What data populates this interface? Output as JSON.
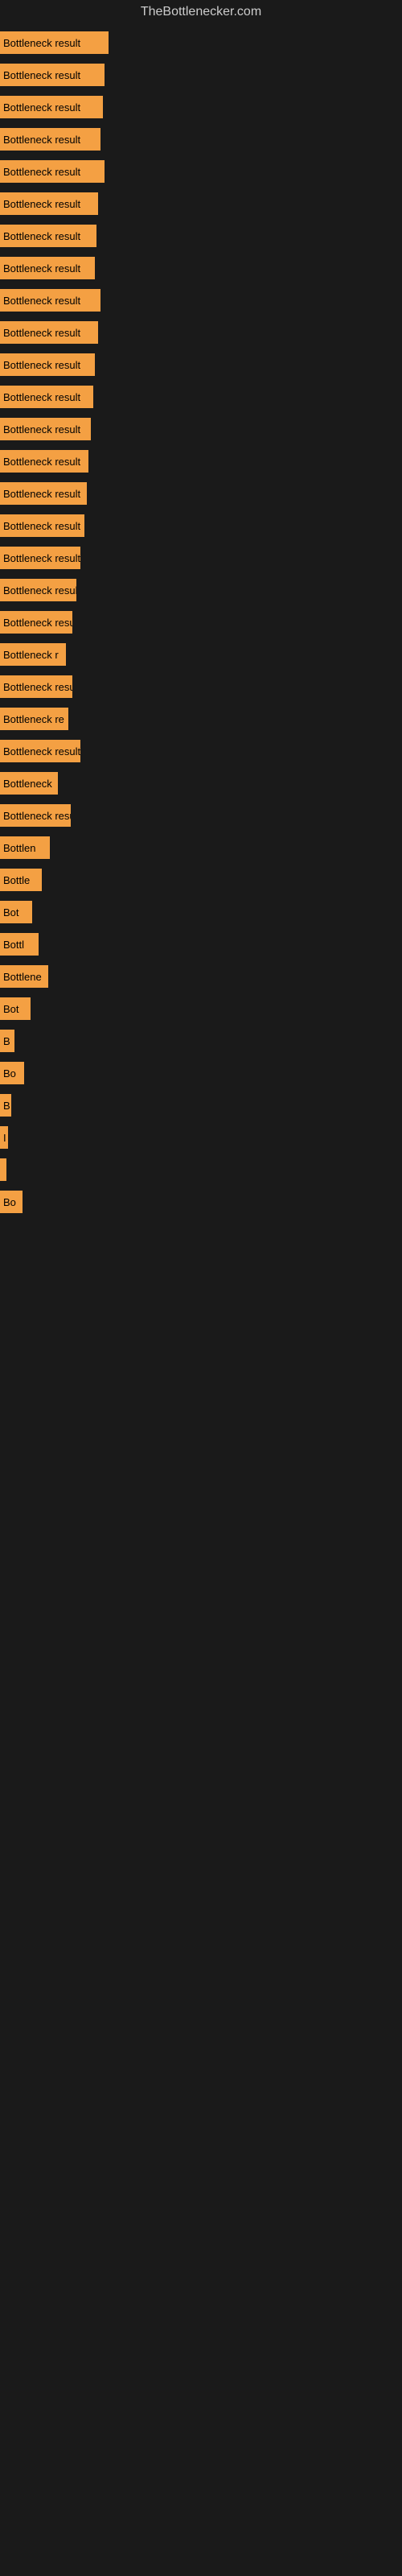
{
  "site": {
    "title": "TheBottlenecker.com"
  },
  "bars": [
    {
      "label": "Bottleneck result",
      "width": 135
    },
    {
      "label": "Bottleneck result",
      "width": 130
    },
    {
      "label": "Bottleneck result",
      "width": 128
    },
    {
      "label": "Bottleneck result",
      "width": 125
    },
    {
      "label": "Bottleneck result",
      "width": 130
    },
    {
      "label": "Bottleneck result",
      "width": 122
    },
    {
      "label": "Bottleneck result",
      "width": 120
    },
    {
      "label": "Bottleneck result",
      "width": 118
    },
    {
      "label": "Bottleneck result",
      "width": 125
    },
    {
      "label": "Bottleneck result",
      "width": 122
    },
    {
      "label": "Bottleneck result",
      "width": 118
    },
    {
      "label": "Bottleneck result",
      "width": 116
    },
    {
      "label": "Bottleneck result",
      "width": 113
    },
    {
      "label": "Bottleneck result",
      "width": 110
    },
    {
      "label": "Bottleneck result",
      "width": 108
    },
    {
      "label": "Bottleneck result",
      "width": 105
    },
    {
      "label": "Bottleneck result",
      "width": 100
    },
    {
      "label": "Bottleneck result",
      "width": 95
    },
    {
      "label": "Bottleneck resu",
      "width": 90
    },
    {
      "label": "Bottleneck r",
      "width": 82
    },
    {
      "label": "Bottleneck resu",
      "width": 90
    },
    {
      "label": "Bottleneck re",
      "width": 85
    },
    {
      "label": "Bottleneck result",
      "width": 100
    },
    {
      "label": "Bottleneck",
      "width": 72
    },
    {
      "label": "Bottleneck resu",
      "width": 88
    },
    {
      "label": "Bottlen",
      "width": 62
    },
    {
      "label": "Bottle",
      "width": 52
    },
    {
      "label": "Bot",
      "width": 40
    },
    {
      "label": "Bottl",
      "width": 48
    },
    {
      "label": "Bottlene",
      "width": 60
    },
    {
      "label": "Bot",
      "width": 38
    },
    {
      "label": "B",
      "width": 18
    },
    {
      "label": "Bo",
      "width": 30
    },
    {
      "label": "B",
      "width": 14
    },
    {
      "label": "I",
      "width": 10
    },
    {
      "label": "",
      "width": 8
    },
    {
      "label": "Bo",
      "width": 28
    }
  ]
}
